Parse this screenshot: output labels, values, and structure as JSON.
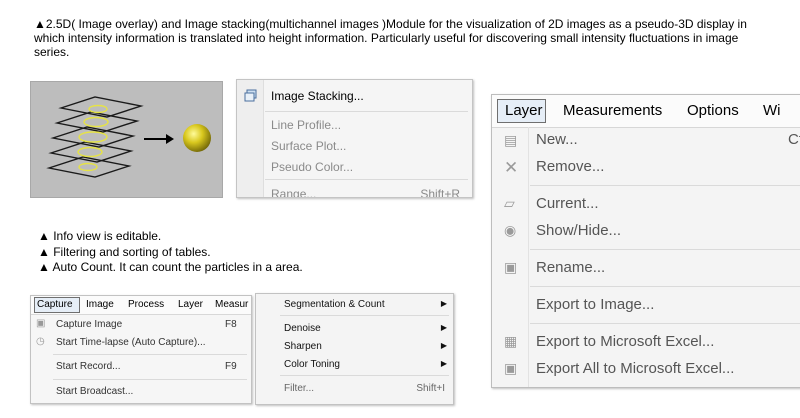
{
  "intro": {
    "text": "▲2.5D( Image overlay) and Image stacking(multichannel images )Module for the visualization of 2D images as a pseudo-3D display in which intensity information is translated into height information. Particularly useful for discovering small intensity fluctuations in image series."
  },
  "bullets": [
    "▲ Info view is editable.",
    "▲ Filtering and sorting of tables.",
    "▲ Auto Count. It can count the particles in a area."
  ],
  "colors": {
    "sphere": "#d2c21a",
    "ring": "#e3e04a",
    "illustration_bg": "#bdbdbd"
  },
  "menu_a": {
    "items": [
      {
        "label": "Image Stacking...",
        "enabled": true,
        "icon": "stack-icon"
      },
      {
        "label": "Line Profile...",
        "enabled": false
      },
      {
        "label": "Surface Plot...",
        "enabled": false
      },
      {
        "label": "Pseudo Color...",
        "enabled": false
      },
      {
        "label": "Range...",
        "enabled": false,
        "shortcut": "Shift+R"
      }
    ]
  },
  "menu_b": {
    "menubar": [
      "Layer",
      "Measurements",
      "Options",
      "Wi"
    ],
    "items": [
      {
        "label": "New...",
        "shortcut": "Ct",
        "icon": "new-layer-icon"
      },
      {
        "label": "Remove...",
        "icon": "remove-icon"
      },
      {
        "label": "Current...",
        "icon": "current-icon"
      },
      {
        "label": "Show/Hide...",
        "icon": "eye-icon"
      },
      {
        "label": "Rename...",
        "icon": "rename-icon"
      },
      {
        "label": "Export to Image..."
      },
      {
        "label": "Export to Microsoft Excel...",
        "icon": "excel-icon"
      },
      {
        "label": "Export All to Microsoft Excel...",
        "icon": "excel-all-icon"
      }
    ]
  },
  "menu_c": {
    "menubar": [
      "Capture",
      "Image",
      "Process",
      "Layer",
      "Measur"
    ],
    "items": [
      {
        "label": "Capture Image",
        "shortcut": "F8",
        "icon": "camera-icon"
      },
      {
        "label": "Start Time-lapse (Auto Capture)...",
        "icon": "clock-icon"
      },
      {
        "label": "Start Record...",
        "shortcut": "F9"
      },
      {
        "label": "Start Broadcast..."
      }
    ]
  },
  "menu_d": {
    "items": [
      {
        "label": "Segmentation & Count",
        "submenu": true
      },
      {
        "label": "Denoise",
        "submenu": true
      },
      {
        "label": "Sharpen",
        "submenu": true
      },
      {
        "label": "Color Toning",
        "submenu": true
      },
      {
        "label": "Filter...",
        "shortcut": "Shift+I"
      }
    ]
  }
}
